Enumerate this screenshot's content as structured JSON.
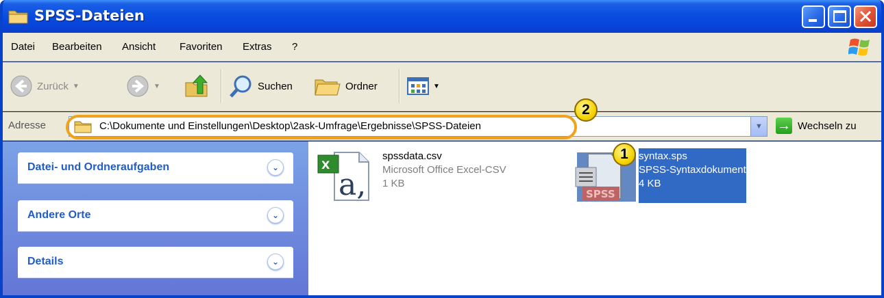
{
  "window": {
    "title": "SPSS-Dateien"
  },
  "menu": {
    "items": [
      "Datei",
      "Bearbeiten",
      "Ansicht",
      "Favoriten",
      "Extras",
      "?"
    ]
  },
  "toolbar": {
    "back_label": "Zurück",
    "search_label": "Suchen",
    "folders_label": "Ordner"
  },
  "address": {
    "label": "Adresse",
    "path": "C:\\Dokumente und Einstellungen\\Desktop\\2ask-Umfrage\\Ergebnisse\\SPSS-Dateien",
    "go_label": "Wechseln zu"
  },
  "callouts": [
    "1",
    "2"
  ],
  "taskpane": {
    "sections": [
      {
        "title": "Datei- und Ordneraufgaben"
      },
      {
        "title": "Andere Orte"
      },
      {
        "title": "Details"
      }
    ]
  },
  "files": [
    {
      "name": "spssdata.csv",
      "type": "Microsoft Office Excel-CSV",
      "size": "1 KB",
      "selected": false,
      "icon": "excel-csv-icon"
    },
    {
      "name": "syntax.sps",
      "type": "SPSS-Syntaxdokument",
      "size": "4 KB",
      "selected": true,
      "icon": "spss-syntax-icon"
    }
  ],
  "colors": {
    "titlebar": "#0a4ee0",
    "callout_border": "#f0a21b",
    "selection": "#316ac5",
    "taskpane_title": "#215dc6"
  }
}
